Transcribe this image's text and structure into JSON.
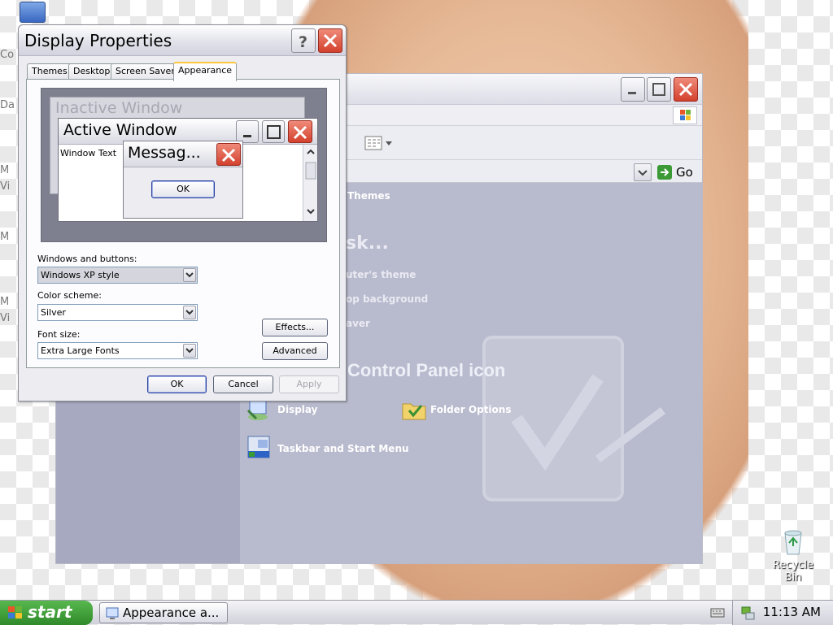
{
  "desktop": {
    "edge_labels": [
      "Co",
      "Da",
      "M",
      "Vi",
      "M",
      "M",
      "Vi"
    ],
    "recycle_bin_label": "Recycle Bin"
  },
  "explorer": {
    "go_label": "Go",
    "themes_link": "Themes",
    "pick_task_fragment": "sk...",
    "task_links": [
      "uter's theme",
      "op background",
      "aver"
    ],
    "section_title": "Control Panel icon",
    "icons": [
      {
        "label": "Display",
        "icon": "display-icon"
      },
      {
        "label": "Folder Options",
        "icon": "folder-options-icon"
      },
      {
        "label": "Taskbar and Start Menu",
        "icon": "taskbar-icon"
      }
    ]
  },
  "dialog": {
    "title": "Display Properties",
    "tabs": [
      "Themes",
      "Desktop",
      "Screen Saver",
      "Appearance"
    ],
    "active_tab": "Appearance",
    "preview": {
      "inactive_title": "Inactive Window",
      "active_title": "Active Window",
      "window_text": "Window Text",
      "message_title": "Messag...",
      "ok_label": "OK"
    },
    "windows_buttons_label": "Windows and buttons:",
    "windows_buttons_value": "Windows XP style",
    "color_scheme_label": "Color scheme:",
    "color_scheme_value": "Silver",
    "font_size_label": "Font size:",
    "font_size_value": "Extra Large Fonts",
    "effects_label": "Effects...",
    "advanced_label": "Advanced",
    "ok_label": "OK",
    "cancel_label": "Cancel",
    "apply_label": "Apply"
  },
  "taskbar": {
    "start_label": "start",
    "task_label": "Appearance a...",
    "clock": "11:13 AM"
  },
  "colors": {
    "start_green": "#3a9a33",
    "close_red": "#d3412d",
    "tab_highlight": "#ffc83c"
  }
}
